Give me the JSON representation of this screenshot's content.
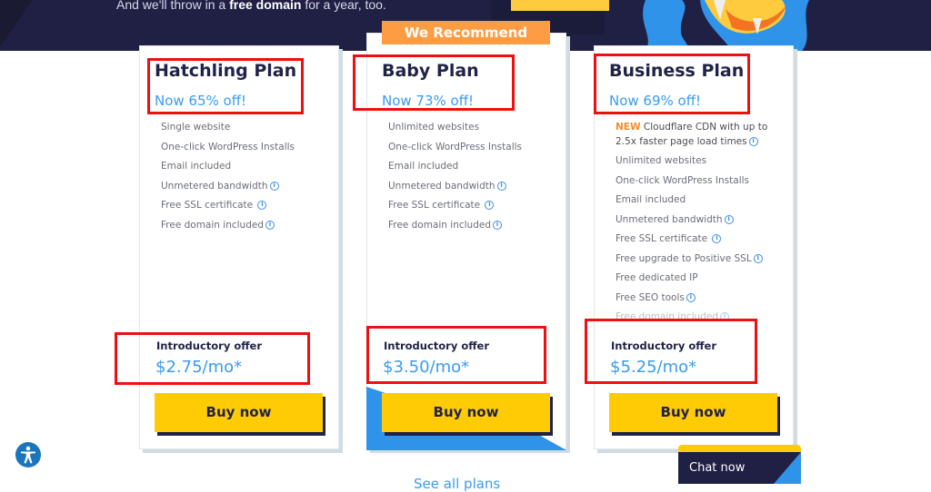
{
  "hero": {
    "text_before": "And we'll throw in a ",
    "text_bold": "free domain",
    "text_after": " for a year, too."
  },
  "badge": {
    "recommend_label": "We Recommend"
  },
  "plans": [
    {
      "name": "Hatchling Plan",
      "discount": "Now 65% off!",
      "features": [
        {
          "text": "Single website",
          "info": false
        },
        {
          "text": "One-click WordPress Installs",
          "info": false
        },
        {
          "text": "Email included",
          "info": false
        },
        {
          "text": "Unmetered bandwidth",
          "info": true
        },
        {
          "text": "Free SSL certificate",
          "info": true
        },
        {
          "text": "Free domain included",
          "info": true
        }
      ],
      "intro_label": "Introductory offer",
      "price": "$2.75/mo*",
      "buy_label": "Buy now"
    },
    {
      "name": "Baby Plan",
      "discount": "Now 73% off!",
      "recommended": true,
      "features": [
        {
          "text": "Unlimited websites",
          "info": false
        },
        {
          "text": "One-click WordPress Installs",
          "info": false
        },
        {
          "text": "Email included",
          "info": false
        },
        {
          "text": "Unmetered bandwidth",
          "info": true
        },
        {
          "text": "Free SSL certificate",
          "info": true
        },
        {
          "text": "Free domain included",
          "info": true
        }
      ],
      "intro_label": "Introductory offer",
      "price": "$3.50/mo*",
      "buy_label": "Buy now"
    },
    {
      "name": "Business Plan",
      "discount": "Now 69% off!",
      "features": [
        {
          "tag": "NEW",
          "text": "Cloudflare CDN with up to 2.5x faster page load times",
          "info": true
        },
        {
          "text": "Unlimited websites",
          "info": false
        },
        {
          "text": "One-click WordPress Installs",
          "info": false
        },
        {
          "text": "Email included",
          "info": false
        },
        {
          "text": "Unmetered bandwidth",
          "info": true
        },
        {
          "text": "Free SSL certificate",
          "info": true
        },
        {
          "text": "Free upgrade to Positive SSL",
          "info": true
        },
        {
          "text": "Free dedicated IP",
          "info": false
        },
        {
          "text": "Free SEO tools",
          "info": true
        },
        {
          "text": "Free domain included",
          "info": true
        }
      ],
      "intro_label": "Introductory offer",
      "price": "$5.25/mo*",
      "buy_label": "Buy now"
    }
  ],
  "chat": {
    "label": "Chat now"
  },
  "footer": {
    "see_all_label": "See all plans"
  },
  "icons": {
    "info": "info-circle-icon",
    "accessibility": "accessibility-icon"
  },
  "colors": {
    "navy": "#1f2044",
    "accent_blue": "#3a9bf0",
    "buy_yellow": "#ffcb05",
    "recommend_orange": "#fd9c43",
    "highlight_red": "#f00f0f"
  }
}
